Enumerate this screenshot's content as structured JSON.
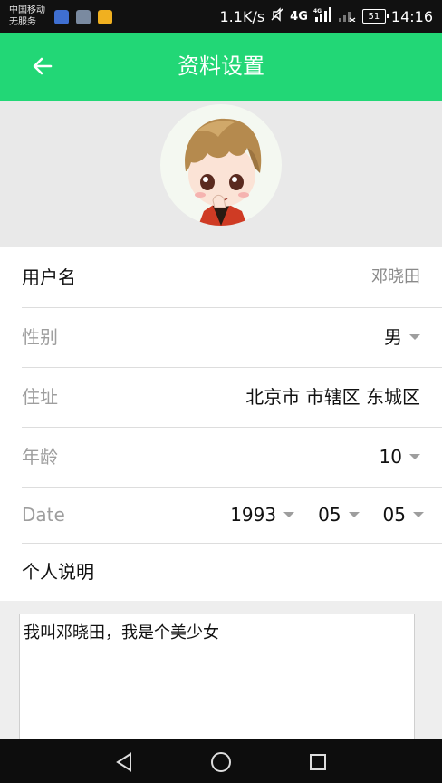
{
  "status_bar": {
    "carrier_line1": "中国移动",
    "carrier_line2": "无服务",
    "speed": "1.1K/s",
    "network": "4G",
    "network2": "4G",
    "battery": "51",
    "time": "14:16"
  },
  "app_bar": {
    "title": "资料设置"
  },
  "form": {
    "username": {
      "label": "用户名",
      "value": "邓晓田"
    },
    "gender": {
      "label": "性别",
      "value": "男"
    },
    "address": {
      "label": "住址",
      "value": "北京市 市辖区 东城区"
    },
    "age": {
      "label": "年龄",
      "value": "10"
    },
    "date": {
      "label": "Date",
      "year": "1993",
      "month": "05",
      "day": "05"
    },
    "bio": {
      "label": "个人说明",
      "text": "我叫邓晓田，我是个美少女"
    }
  },
  "colors": {
    "accent": "#22d776",
    "muted": "#9e9e9e"
  }
}
